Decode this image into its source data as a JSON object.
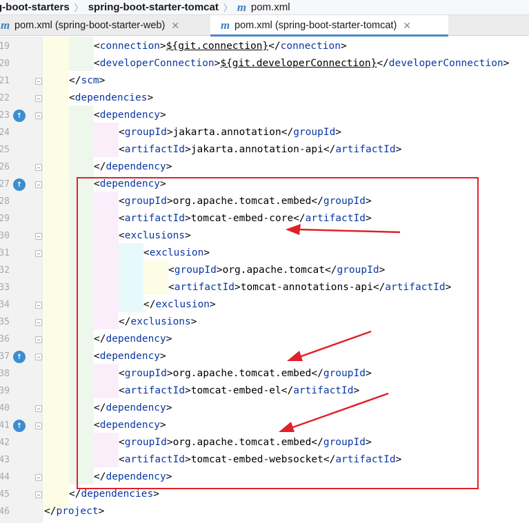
{
  "breadcrumb": {
    "items": [
      "g-boot-starters",
      "spring-boot-starter-tomcat",
      "pom.xml"
    ]
  },
  "tabs": [
    {
      "label": "pom.xml (spring-boot-starter-web)",
      "active": false,
      "icon": "maven-m-icon"
    },
    {
      "label": "pom.xml (spring-boot-starter-tomcat)",
      "active": true,
      "icon": "maven-m-icon"
    }
  ],
  "colors": {
    "tag": "#0b37a3",
    "annotation_red": "#e0202a",
    "active_tab_underline": "#4a88c7",
    "override_icon": "#3d8dd1"
  },
  "editor": {
    "lines": [
      {
        "num": "19",
        "indent": 2,
        "segments": [
          [
            "br",
            "<"
          ],
          [
            "tag",
            "connection"
          ],
          [
            "br",
            ">"
          ],
          [
            "prop",
            "${git.connection}"
          ],
          [
            "br",
            "</"
          ],
          [
            "tag",
            "connection"
          ],
          [
            "br",
            ">"
          ]
        ]
      },
      {
        "num": "20",
        "indent": 2,
        "segments": [
          [
            "br",
            "<"
          ],
          [
            "tag",
            "developerConnection"
          ],
          [
            "br",
            ">"
          ],
          [
            "prop",
            "${git.developerConnection}"
          ],
          [
            "br",
            "</"
          ],
          [
            "tag",
            "developerConnection"
          ],
          [
            "br",
            ">"
          ]
        ]
      },
      {
        "num": "21",
        "indent": 1,
        "segments": [
          [
            "br",
            "</"
          ],
          [
            "tag",
            "scm"
          ],
          [
            "br",
            ">"
          ]
        ]
      },
      {
        "num": "22",
        "indent": 1,
        "segments": [
          [
            "br",
            "<"
          ],
          [
            "tag",
            "dependencies"
          ],
          [
            "br",
            ">"
          ]
        ]
      },
      {
        "num": "23",
        "indent": 2,
        "override": true,
        "segments": [
          [
            "br",
            "<"
          ],
          [
            "tag",
            "dependency"
          ],
          [
            "br",
            ">"
          ]
        ]
      },
      {
        "num": "24",
        "indent": 3,
        "segments": [
          [
            "br",
            "<"
          ],
          [
            "tag",
            "groupId"
          ],
          [
            "br",
            ">"
          ],
          [
            "txt",
            "jakarta.annotation"
          ],
          [
            "br",
            "</"
          ],
          [
            "tag",
            "groupId"
          ],
          [
            "br",
            ">"
          ]
        ]
      },
      {
        "num": "25",
        "indent": 3,
        "segments": [
          [
            "br",
            "<"
          ],
          [
            "tag",
            "artifactId"
          ],
          [
            "br",
            ">"
          ],
          [
            "txt",
            "jakarta.annotation-api"
          ],
          [
            "br",
            "</"
          ],
          [
            "tag",
            "artifactId"
          ],
          [
            "br",
            ">"
          ]
        ]
      },
      {
        "num": "26",
        "indent": 2,
        "segments": [
          [
            "br",
            "</"
          ],
          [
            "tag",
            "dependency"
          ],
          [
            "br",
            ">"
          ]
        ]
      },
      {
        "num": "27",
        "indent": 2,
        "override": true,
        "segments": [
          [
            "br",
            "<"
          ],
          [
            "tag",
            "dependency"
          ],
          [
            "br",
            ">"
          ]
        ]
      },
      {
        "num": "28",
        "indent": 3,
        "segments": [
          [
            "br",
            "<"
          ],
          [
            "tag",
            "groupId"
          ],
          [
            "br",
            ">"
          ],
          [
            "txt",
            "org.apache.tomcat.embed"
          ],
          [
            "br",
            "</"
          ],
          [
            "tag",
            "groupId"
          ],
          [
            "br",
            ">"
          ]
        ]
      },
      {
        "num": "29",
        "indent": 3,
        "segments": [
          [
            "br",
            "<"
          ],
          [
            "tag",
            "artifactId"
          ],
          [
            "br",
            ">"
          ],
          [
            "txt",
            "tomcat-embed-core"
          ],
          [
            "br",
            "</"
          ],
          [
            "tag",
            "artifactId"
          ],
          [
            "br",
            ">"
          ]
        ]
      },
      {
        "num": "30",
        "indent": 3,
        "segments": [
          [
            "br",
            "<"
          ],
          [
            "tag",
            "exclusions"
          ],
          [
            "br",
            ">"
          ]
        ]
      },
      {
        "num": "31",
        "indent": 4,
        "segments": [
          [
            "br",
            "<"
          ],
          [
            "tag",
            "exclusion"
          ],
          [
            "br",
            ">"
          ]
        ]
      },
      {
        "num": "32",
        "indent": 5,
        "segments": [
          [
            "br",
            "<"
          ],
          [
            "tag",
            "groupId"
          ],
          [
            "br",
            ">"
          ],
          [
            "txt",
            "org.apache.tomcat"
          ],
          [
            "br",
            "</"
          ],
          [
            "tag",
            "groupId"
          ],
          [
            "br",
            ">"
          ]
        ]
      },
      {
        "num": "33",
        "indent": 5,
        "segments": [
          [
            "br",
            "<"
          ],
          [
            "tag",
            "artifactId"
          ],
          [
            "br",
            ">"
          ],
          [
            "txt",
            "tomcat-annotations-api"
          ],
          [
            "br",
            "</"
          ],
          [
            "tag",
            "artifactId"
          ],
          [
            "br",
            ">"
          ]
        ]
      },
      {
        "num": "34",
        "indent": 4,
        "segments": [
          [
            "br",
            "</"
          ],
          [
            "tag",
            "exclusion"
          ],
          [
            "br",
            ">"
          ]
        ]
      },
      {
        "num": "35",
        "indent": 3,
        "segments": [
          [
            "br",
            "</"
          ],
          [
            "tag",
            "exclusions"
          ],
          [
            "br",
            ">"
          ]
        ]
      },
      {
        "num": "36",
        "indent": 2,
        "segments": [
          [
            "br",
            "</"
          ],
          [
            "tag",
            "dependency"
          ],
          [
            "br",
            ">"
          ]
        ]
      },
      {
        "num": "37",
        "indent": 2,
        "override": true,
        "segments": [
          [
            "br",
            "<"
          ],
          [
            "tag",
            "dependency"
          ],
          [
            "br",
            ">"
          ]
        ]
      },
      {
        "num": "38",
        "indent": 3,
        "segments": [
          [
            "br",
            "<"
          ],
          [
            "tag",
            "groupId"
          ],
          [
            "br",
            ">"
          ],
          [
            "txt",
            "org.apache.tomcat.embed"
          ],
          [
            "br",
            "</"
          ],
          [
            "tag",
            "groupId"
          ],
          [
            "br",
            ">"
          ]
        ]
      },
      {
        "num": "39",
        "indent": 3,
        "segments": [
          [
            "br",
            "<"
          ],
          [
            "tag",
            "artifactId"
          ],
          [
            "br",
            ">"
          ],
          [
            "txt",
            "tomcat-embed-el"
          ],
          [
            "br",
            "</"
          ],
          [
            "tag",
            "artifactId"
          ],
          [
            "br",
            ">"
          ]
        ]
      },
      {
        "num": "40",
        "indent": 2,
        "segments": [
          [
            "br",
            "</"
          ],
          [
            "tag",
            "dependency"
          ],
          [
            "br",
            ">"
          ]
        ]
      },
      {
        "num": "41",
        "indent": 2,
        "override": true,
        "segments": [
          [
            "br",
            "<"
          ],
          [
            "tag",
            "dependency"
          ],
          [
            "br",
            ">"
          ]
        ]
      },
      {
        "num": "42",
        "indent": 3,
        "segments": [
          [
            "br",
            "<"
          ],
          [
            "tag",
            "groupId"
          ],
          [
            "br",
            ">"
          ],
          [
            "txt",
            "org.apache.tomcat.embed"
          ],
          [
            "br",
            "</"
          ],
          [
            "tag",
            "groupId"
          ],
          [
            "br",
            ">"
          ]
        ]
      },
      {
        "num": "43",
        "indent": 3,
        "segments": [
          [
            "br",
            "<"
          ],
          [
            "tag",
            "artifactId"
          ],
          [
            "br",
            ">"
          ],
          [
            "txt",
            "tomcat-embed-websocket"
          ],
          [
            "br",
            "</"
          ],
          [
            "tag",
            "artifactId"
          ],
          [
            "br",
            ">"
          ]
        ]
      },
      {
        "num": "44",
        "indent": 2,
        "segments": [
          [
            "br",
            "</"
          ],
          [
            "tag",
            "dependency"
          ],
          [
            "br",
            ">"
          ]
        ]
      },
      {
        "num": "45",
        "indent": 1,
        "segments": [
          [
            "br",
            "</"
          ],
          [
            "tag",
            "dependencies"
          ],
          [
            "br",
            ">"
          ]
        ]
      },
      {
        "num": "46",
        "indent": 0,
        "segments": [
          [
            "br",
            "</"
          ],
          [
            "tag",
            "project"
          ],
          [
            "br",
            ">"
          ]
        ]
      }
    ]
  }
}
